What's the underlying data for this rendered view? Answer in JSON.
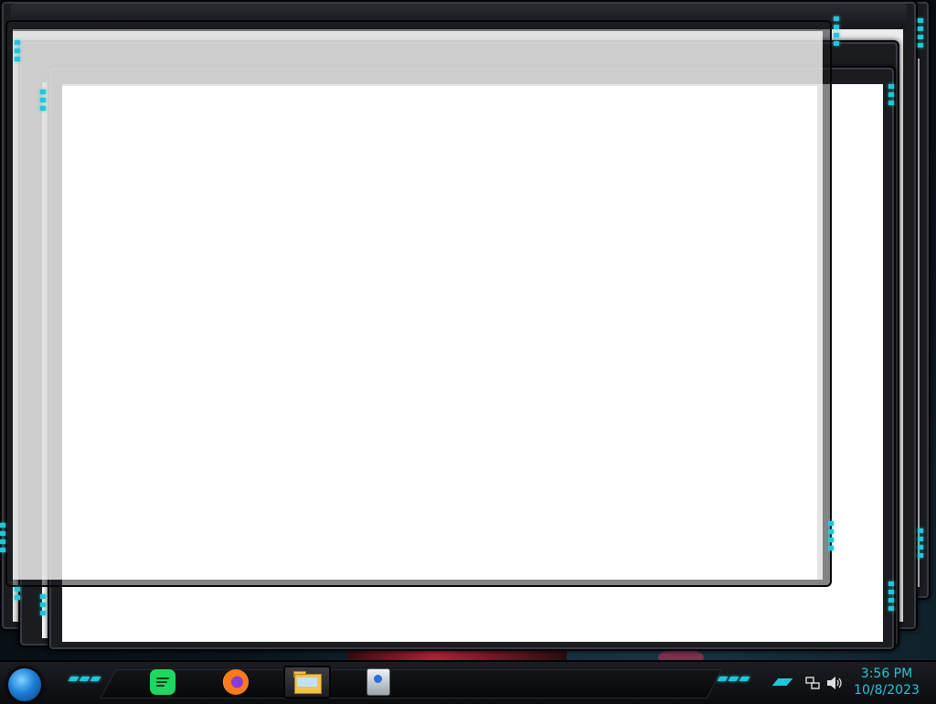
{
  "taskbar": {
    "start_button": "Start",
    "apps": [
      {
        "name": "Spotify",
        "icon": "spotify-icon"
      },
      {
        "name": "Firefox",
        "icon": "firefox-icon"
      },
      {
        "name": "File Explorer",
        "icon": "folder-icon",
        "active": true
      },
      {
        "name": "Control Panel",
        "icon": "control-panel-icon"
      }
    ],
    "tray": {
      "network_icon": "network-icon",
      "volume_icon": "volume-icon",
      "show_hidden_icon": "chevron-up-icon"
    },
    "clock": {
      "time": "3:56 PM",
      "date": "10/8/2023"
    }
  },
  "theme": {
    "accent": "#21c7d8",
    "frame": "#1b1c20",
    "client": "#f2f2f2"
  }
}
